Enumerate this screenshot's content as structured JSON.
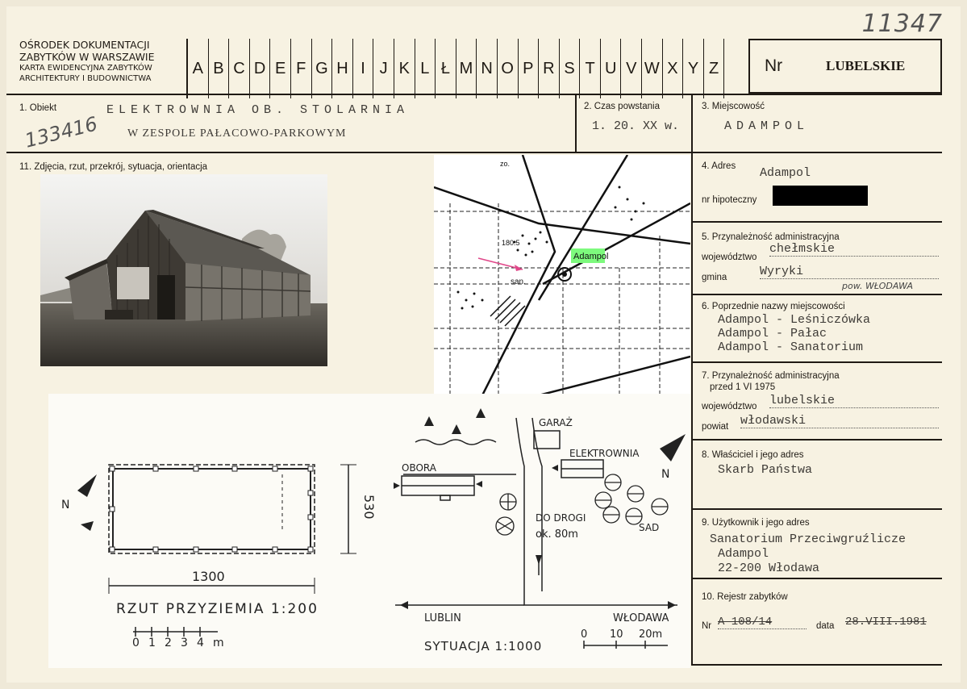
{
  "header": {
    "org_line1": "OŚRODEK DOKUMENTACJI",
    "org_line2": "ZABYTKÓW W WARSZAWIE",
    "org_line3": "KARTA EWIDENCYJNA ZABYTKÓW",
    "org_line4": "ARCHITEKTURY I BUDOWNICTWA",
    "letters": [
      "A",
      "B",
      "C",
      "D",
      "E",
      "F",
      "G",
      "H",
      "I",
      "J",
      "K",
      "L",
      "Ł",
      "M",
      "N",
      "O",
      "P",
      "R",
      "S",
      "T",
      "U",
      "V",
      "W",
      "X",
      "Y",
      "Z"
    ],
    "nr_label": "Nr",
    "region": "LUBELSKIE",
    "handwritten_number": "11347"
  },
  "section1": {
    "label": "1. Obiekt",
    "name_line1": "ELEKTROWNIA OB. STOLARNIA",
    "name_line2": "W ZESPOLE PAŁACOWO-PARKOWYM",
    "handwritten_id": "133416"
  },
  "section2": {
    "label": "2. Czas powstania",
    "value": "1. 20. XX w."
  },
  "section3": {
    "label": "3. Miejscowość",
    "value": "ADAMPOL"
  },
  "section4": {
    "label": "4. Adres",
    "value": "Adampol",
    "hipoteczny_label": "nr hipoteczny"
  },
  "section5": {
    "label": "5. Przynależność administracyjna",
    "woj_label": "województwo",
    "woj_value": "chełmskie",
    "gmina_label": "gmina",
    "gmina_value": "Wyryki",
    "powiat_note": "pow. WŁODAWA"
  },
  "section6": {
    "label": "6. Poprzednie nazwy miejscowości",
    "names": [
      "Adampol - Leśniczówka",
      "Adampol - Pałac",
      "Adampol - Sanatorium"
    ]
  },
  "section7": {
    "label_line1": "7. Przynależność administracyjna",
    "label_line2": "przed 1 VI 1975",
    "woj_label": "województwo",
    "woj_value": "lubelskie",
    "powiat_label": "powiat",
    "powiat_value": "włodawski"
  },
  "section8": {
    "label": "8. Właściciel i jego adres",
    "value": "Skarb Państwa"
  },
  "section9": {
    "label": "9. Użytkownik i jego adres",
    "lines": [
      "Sanatorium Przeciwgruźlicze",
      "Adampol",
      "22-200 Włodawa"
    ]
  },
  "section10": {
    "label": "10. Rejestr zabytków",
    "nr_label": "Nr",
    "nr_value": "A 108/14",
    "data_label": "data",
    "data_value": "28.VIII.1981"
  },
  "section11": {
    "label": "11. Zdjęcia, rzut, przekrój, sytuacja, orientacja"
  },
  "map": {
    "place_label": "Adampol",
    "elevation": "180.5",
    "san_label": "san.",
    "zo_label": "zo."
  },
  "plan": {
    "width_dim": "1300",
    "depth_dim": "530",
    "title": "RZUT  PRZYZIEMIA 1:200",
    "scale_labels": [
      "0",
      "1",
      "2",
      "3",
      "4",
      "m"
    ],
    "north": "N"
  },
  "situation": {
    "garage": "GARAŻ",
    "plant": "ELEKTROWNIA",
    "barn": "OBORA",
    "road_note_1": "DO DROGI",
    "road_note_2": "ok. 80m",
    "orchard": "SAD",
    "left_road": "LUBLIN",
    "right_road": "WŁODAWA",
    "title": "SYTUACJA  1:1000",
    "scale_labels": [
      "0",
      "10",
      "20m"
    ],
    "north": "N"
  }
}
